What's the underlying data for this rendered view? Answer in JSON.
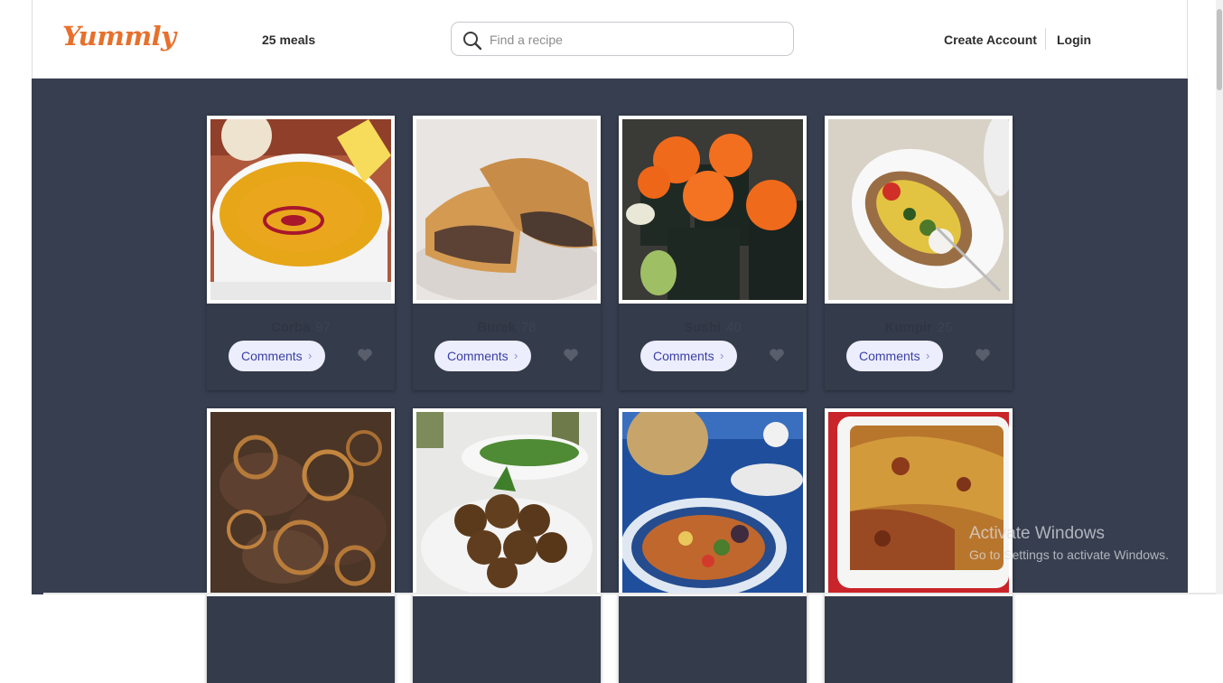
{
  "header": {
    "logo_text": "Yummly",
    "meals_count": "25 meals",
    "search_placeholder": "Find a recipe",
    "search_icon": "search-icon",
    "create_account_label": "Create Account",
    "login_label": "Login"
  },
  "colors": {
    "page_background": "#363e4f",
    "brand_orange": "#e6702c",
    "button_background": "#eceefe",
    "button_text": "#3a3fa6"
  },
  "recipes": [
    {
      "name": "Corba",
      "count": "97",
      "comments_label": "Comments",
      "photo_icon": "lentil-soup-photo",
      "favorite_icon": "heart-icon"
    },
    {
      "name": "Burek",
      "count": "78",
      "comments_label": "Comments",
      "photo_icon": "meat-pie-photo",
      "favorite_icon": "heart-icon"
    },
    {
      "name": "Sushi",
      "count": "40",
      "comments_label": "Comments",
      "photo_icon": "sushi-rolls-photo",
      "favorite_icon": "heart-icon"
    },
    {
      "name": "Kumpir",
      "count": "25",
      "comments_label": "Comments",
      "photo_icon": "stuffed-potato-photo",
      "favorite_icon": "heart-icon"
    },
    {
      "name": "",
      "count": "",
      "comments_label": "",
      "photo_icon": "grilled-liver-onions-photo",
      "favorite_icon": ""
    },
    {
      "name": "",
      "count": "",
      "comments_label": "",
      "photo_icon": "falafel-photo",
      "favorite_icon": ""
    },
    {
      "name": "",
      "count": "",
      "comments_label": "",
      "photo_icon": "vegetable-plate-photo",
      "favorite_icon": ""
    },
    {
      "name": "",
      "count": "",
      "comments_label": "",
      "photo_icon": "lasagna-photo",
      "favorite_icon": ""
    }
  ],
  "watermark": {
    "title": "Activate Windows",
    "subtitle": "Go to Settings to activate Windows."
  }
}
